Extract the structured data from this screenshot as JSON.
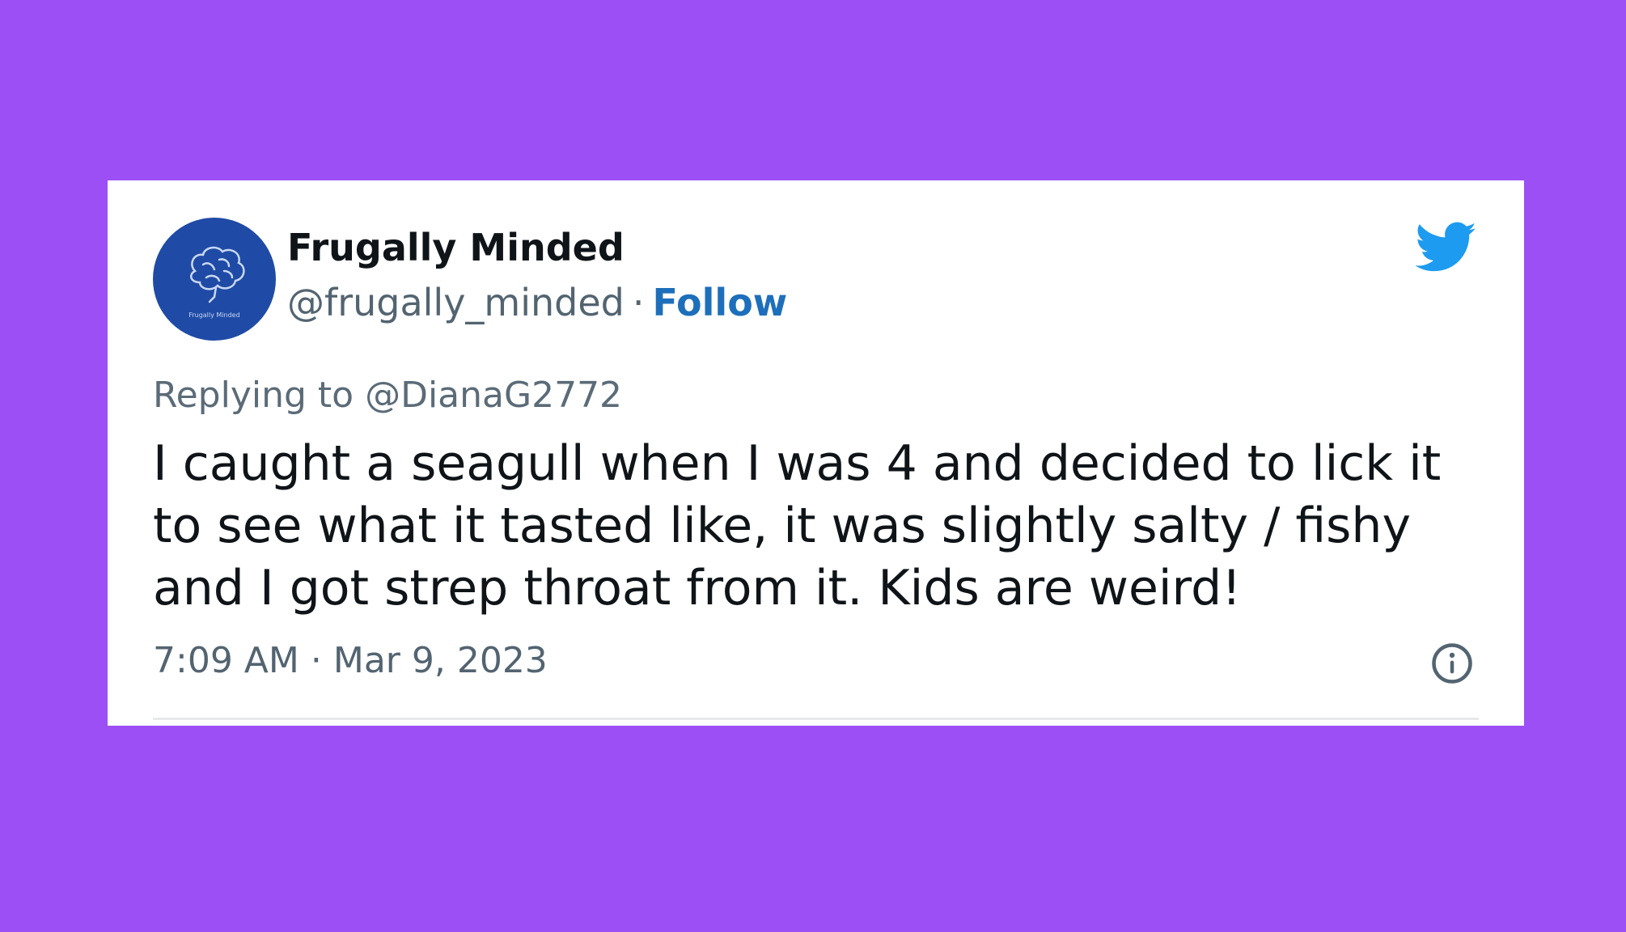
{
  "tweet": {
    "display_name": "Frugally Minded",
    "handle": "@frugally_minded",
    "separator": "·",
    "follow_label": "Follow",
    "reply_prefix": "Replying to",
    "reply_to": "@DianaG2772",
    "text": "I caught a seagull when I was 4 and decided to lick it to see what it tasted like, it was slightly salty / fishy and I got strep throat from it. Kids are weird!",
    "time": "7:09 AM",
    "date": "Mar 9, 2023",
    "avatar_caption": "Frugally Minded",
    "icons": {
      "brand": "twitter-bird-icon",
      "info": "info-icon",
      "avatar": "brain-icon"
    }
  },
  "colors": {
    "background": "#9b4ff5",
    "card": "#ffffff",
    "follow": "#1d6fbb",
    "twitter_blue": "#1d9bf0",
    "avatar_bg": "#1f4ba6"
  }
}
